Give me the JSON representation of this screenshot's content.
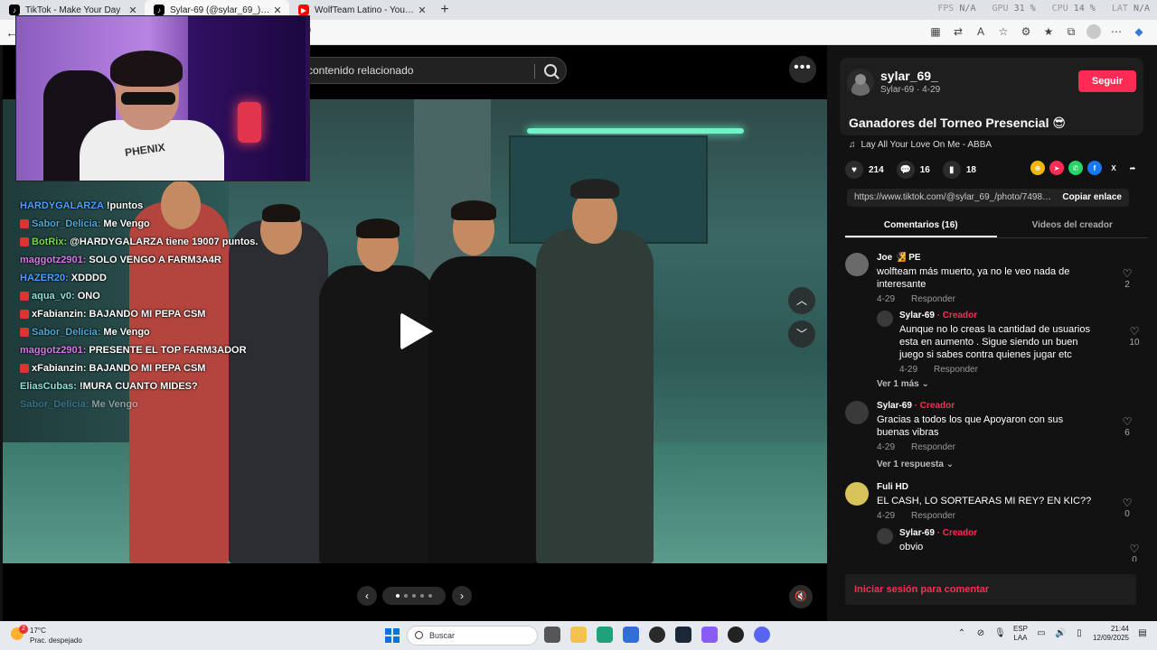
{
  "browser": {
    "tabs": [
      {
        "title": "TikTok - Make Your Day",
        "icon": "tiktok-icon",
        "color": "#000000",
        "active": false
      },
      {
        "title": "Sylar-69 (@sylar_69_) | TikTok",
        "icon": "tiktok-icon",
        "color": "#000000",
        "active": true
      },
      {
        "title": "WolfTeam Latino - YouTube",
        "icon": "youtube-icon",
        "color": "#ff0000",
        "active": false
      }
    ],
    "url_fragment": "9",
    "perf": {
      "fps_label": "FPS",
      "fps": "N/A",
      "gpu_label": "GPU",
      "gpu": "31 %",
      "cpu_label": "CPU",
      "cpu": "14 %",
      "lat_label": "LAT",
      "lat": "N/A"
    }
  },
  "video": {
    "search_placeholder": "contenido relacionado",
    "more_label": "•••",
    "carousel_dots": 5,
    "active_dot": 0
  },
  "webcam_overlay": {
    "shirt_text": "PHENIX"
  },
  "chat": [
    {
      "user": "HARDYGALARZA",
      "color": "#4ea0ff",
      "msg": "!puntos",
      "badge": false
    },
    {
      "user": "Sabor_Delicia:",
      "color": "#4ea8d6",
      "msg": "Me Vengo",
      "badge": true
    },
    {
      "user": "BotRix:",
      "color": "#7ad84a",
      "msg": "@HARDYGALARZA tiene 19007 puntos.",
      "badge": true
    },
    {
      "user": "maggotz2901:",
      "color": "#d37be3",
      "msg": "SOLO VENGO A FARM3A4R",
      "badge": false
    },
    {
      "user": "HAZER20:",
      "color": "#4ea0ff",
      "msg": "XDDDD",
      "badge": false
    },
    {
      "user": "aqua_v0:",
      "color": "#8fe0d6",
      "msg": "ONO",
      "badge": true
    },
    {
      "user": "xFabianzin:",
      "color": "#ffffff",
      "msg": "BAJANDO MI PEPA CSM",
      "badge": true
    },
    {
      "user": "Sabor_Delicia:",
      "color": "#4ea8d6",
      "msg": "Me Vengo",
      "badge": true
    },
    {
      "user": "maggotz2901:",
      "color": "#d37be3",
      "msg": "PRESENTE EL TOP FARM3ADOR",
      "badge": false
    },
    {
      "user": "xFabianzin:",
      "color": "#ffffff",
      "msg": "BAJANDO MI PEPA CSM",
      "badge": true
    },
    {
      "user": "EliasCubas:",
      "color": "#8fe0d6",
      "msg": "!MURA CUANTO MIDES?",
      "badge": false
    },
    {
      "user": "Sabor_Delicia:",
      "color": "#4ea8d6",
      "msg": "Me Vengo",
      "badge": false,
      "faded": true
    }
  ],
  "post": {
    "creator_handle": "sylar_69_",
    "creator_sub": "Sylar-69 · 4-29",
    "follow_label": "Seguir",
    "title": "Ganadores del Torneo Presencial 😎",
    "music": "Lay All Your Love On Me - ABBA",
    "likes": "214",
    "comments": "16",
    "saves": "18",
    "share_url": "https://www.tiktok.com/@sylar_69_/photo/74987...",
    "copy_label": "Copiar enlace",
    "tab_comments": "Comentarios (16)",
    "tab_videos": "Videos del creador",
    "accent": "#fe2c55"
  },
  "comments": [
    {
      "name": "Joe",
      "emoji": "🧏 PE",
      "text": "wolfteam más muerto, ya no le veo nada de interesante",
      "date": "4-29",
      "reply": "Responder",
      "likes": "2"
    },
    {
      "name": "Sylar-69",
      "creator": "· Creador",
      "text": "Aunque no lo creas la cantidad de usuarios esta en aumento . Sigue siendo un buen juego si sabes contra quienes jugar etc",
      "date": "4-29",
      "reply": "Responder",
      "likes": "10"
    },
    {
      "more": "Ver 1 más"
    },
    {
      "name": "Sylar-69",
      "creator": "· Creador",
      "text": "Gracias a todos los que Apoyaron con sus buenas vibras",
      "date": "4-29",
      "reply": "Responder",
      "likes": "6"
    },
    {
      "more": "Ver 1 respuesta"
    },
    {
      "name": "Fuli HD",
      "text": "EL CASH, LO SORTEARAS MI REY? EN KIC??",
      "date": "4-29",
      "reply": "Responder",
      "likes": "0"
    },
    {
      "name": "Sylar-69",
      "creator": "· Creador",
      "text": "obvio",
      "date": "4-29",
      "reply": "Responder",
      "likes": "0"
    }
  ],
  "login_label": "Iniciar sesión para comentar",
  "taskbar": {
    "temp": "17°C",
    "condition": "Prac. despejado",
    "weather_badge": "2",
    "search_label": "Buscar",
    "lang_top": "ESP",
    "lang_bottom": "LAA",
    "time": "21:44",
    "date": "12/09/2025"
  }
}
